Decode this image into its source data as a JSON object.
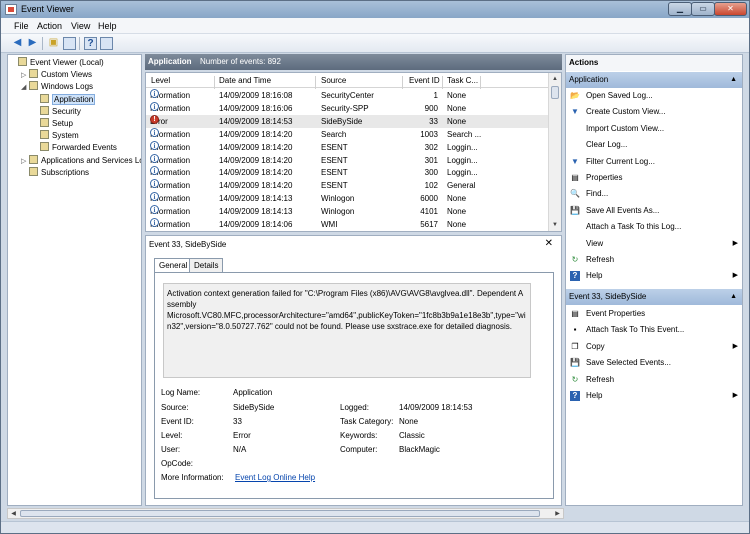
{
  "window": {
    "title": "Event Viewer"
  },
  "menu": [
    "File",
    "Action",
    "View",
    "Help"
  ],
  "tree": [
    {
      "label": "Event Viewer (Local)",
      "level": 0,
      "expander": ""
    },
    {
      "label": "Custom Views",
      "level": 1,
      "expander": "▷"
    },
    {
      "label": "Windows Logs",
      "level": 1,
      "expander": "◢"
    },
    {
      "label": "Application",
      "level": 2,
      "expander": "",
      "selected": true
    },
    {
      "label": "Security",
      "level": 2,
      "expander": ""
    },
    {
      "label": "Setup",
      "level": 2,
      "expander": ""
    },
    {
      "label": "System",
      "level": 2,
      "expander": ""
    },
    {
      "label": "Forwarded Events",
      "level": 2,
      "expander": ""
    },
    {
      "label": "Applications and Services Lo",
      "level": 1,
      "expander": "▷"
    },
    {
      "label": "Subscriptions",
      "level": 1,
      "expander": ""
    }
  ],
  "log_header": {
    "name": "Application",
    "count_text": "Number of events: 892"
  },
  "columns": [
    "Level",
    "Date and Time",
    "Source",
    "Event ID",
    "Task C..."
  ],
  "events": [
    {
      "level": "Information",
      "datetime": "14/09/2009 18:16:08",
      "source": "SecurityCenter",
      "id": "1",
      "task": "None"
    },
    {
      "level": "Information",
      "datetime": "14/09/2009 18:16:06",
      "source": "Security-SPP",
      "id": "900",
      "task": "None"
    },
    {
      "level": "Error",
      "datetime": "14/09/2009 18:14:53",
      "source": "SideBySide",
      "id": "33",
      "task": "None",
      "selected": true
    },
    {
      "level": "Information",
      "datetime": "14/09/2009 18:14:20",
      "source": "Search",
      "id": "1003",
      "task": "Search ..."
    },
    {
      "level": "Information",
      "datetime": "14/09/2009 18:14:20",
      "source": "ESENT",
      "id": "302",
      "task": "Loggin..."
    },
    {
      "level": "Information",
      "datetime": "14/09/2009 18:14:20",
      "source": "ESENT",
      "id": "301",
      "task": "Loggin..."
    },
    {
      "level": "Information",
      "datetime": "14/09/2009 18:14:20",
      "source": "ESENT",
      "id": "300",
      "task": "Loggin..."
    },
    {
      "level": "Information",
      "datetime": "14/09/2009 18:14:20",
      "source": "ESENT",
      "id": "102",
      "task": "General"
    },
    {
      "level": "Information",
      "datetime": "14/09/2009 18:14:13",
      "source": "Winlogon",
      "id": "6000",
      "task": "None"
    },
    {
      "level": "Information",
      "datetime": "14/09/2009 18:14:13",
      "source": "Winlogon",
      "id": "4101",
      "task": "None"
    },
    {
      "level": "Information",
      "datetime": "14/09/2009 18:14:06",
      "source": "WMI",
      "id": "5617",
      "task": "None"
    }
  ],
  "detail": {
    "title": "Event 33, SideBySide",
    "tabs": [
      "General",
      "Details"
    ],
    "message": [
      "Activation context generation failed for \"C:\\Program Files (x86)\\AVG\\AVG8\\avglvea.dll\". Dependent Assembly",
      "Microsoft.VC80.MFC,processorArchitecture=\"amd64\",publicKeyToken=\"1fc8b3b9a1e18e3b\",type=\"win32\",version=\"8.0.50727.762\" could not be found. Please use sxstrace.exe for detailed diagnosis."
    ],
    "labels": {
      "log_name": "Log Name:",
      "source": "Source:",
      "event_id": "Event ID:",
      "level": "Level:",
      "user": "User:",
      "opcode": "OpCode:",
      "more_info": "More Information:",
      "logged": "Logged:",
      "task_category": "Task Category:",
      "keywords": "Keywords:",
      "computer": "Computer:"
    },
    "values": {
      "log_name": "Application",
      "source": "SideBySide",
      "event_id": "33",
      "level": "Error",
      "user": "N/A",
      "opcode": "",
      "more_info": "Event Log Online Help",
      "logged": "14/09/2009 18:14:53",
      "task_category": "None",
      "keywords": "Classic",
      "computer": "BlackMagic"
    }
  },
  "actions": {
    "title": "Actions",
    "section1": "Application",
    "items1": [
      {
        "label": "Open Saved Log...",
        "icon": "open-folder-icon",
        "glyph": "📂",
        "sub": false
      },
      {
        "label": "Create Custom View...",
        "icon": "filter-new-icon",
        "glyph": "▼",
        "sub": false
      },
      {
        "label": "Import Custom View...",
        "icon": "",
        "glyph": "",
        "sub": false
      },
      {
        "label": "Clear Log...",
        "icon": "",
        "glyph": "",
        "sub": false
      },
      {
        "label": "Filter Current Log...",
        "icon": "filter-icon",
        "glyph": "▼",
        "sub": false
      },
      {
        "label": "Properties",
        "icon": "properties-icon",
        "glyph": "▤",
        "sub": false
      },
      {
        "label": "Find...",
        "icon": "find-icon",
        "glyph": "🔍",
        "sub": false
      },
      {
        "label": "Save All Events As...",
        "icon": "save-icon",
        "glyph": "💾",
        "sub": false
      },
      {
        "label": "Attach a Task To this Log...",
        "icon": "",
        "glyph": "",
        "sub": false
      },
      {
        "label": "View",
        "icon": "",
        "glyph": "",
        "sub": true
      },
      {
        "label": "Refresh",
        "icon": "refresh-icon",
        "glyph": "↻",
        "sub": false
      },
      {
        "label": "Help",
        "icon": "help-icon",
        "glyph": "?",
        "sub": true
      }
    ],
    "section2": "Event 33, SideBySide",
    "items2": [
      {
        "label": "Event Properties",
        "icon": "properties-icon",
        "glyph": "▤",
        "sub": false
      },
      {
        "label": "Attach Task To This Event...",
        "icon": "task-icon",
        "glyph": "▪",
        "sub": false
      },
      {
        "label": "Copy",
        "icon": "copy-icon",
        "glyph": "❐",
        "sub": true
      },
      {
        "label": "Save Selected Events...",
        "icon": "save-icon",
        "glyph": "💾",
        "sub": false
      },
      {
        "label": "Refresh",
        "icon": "refresh-icon",
        "glyph": "↻",
        "sub": false
      },
      {
        "label": "Help",
        "icon": "help-icon",
        "glyph": "?",
        "sub": true
      }
    ]
  }
}
